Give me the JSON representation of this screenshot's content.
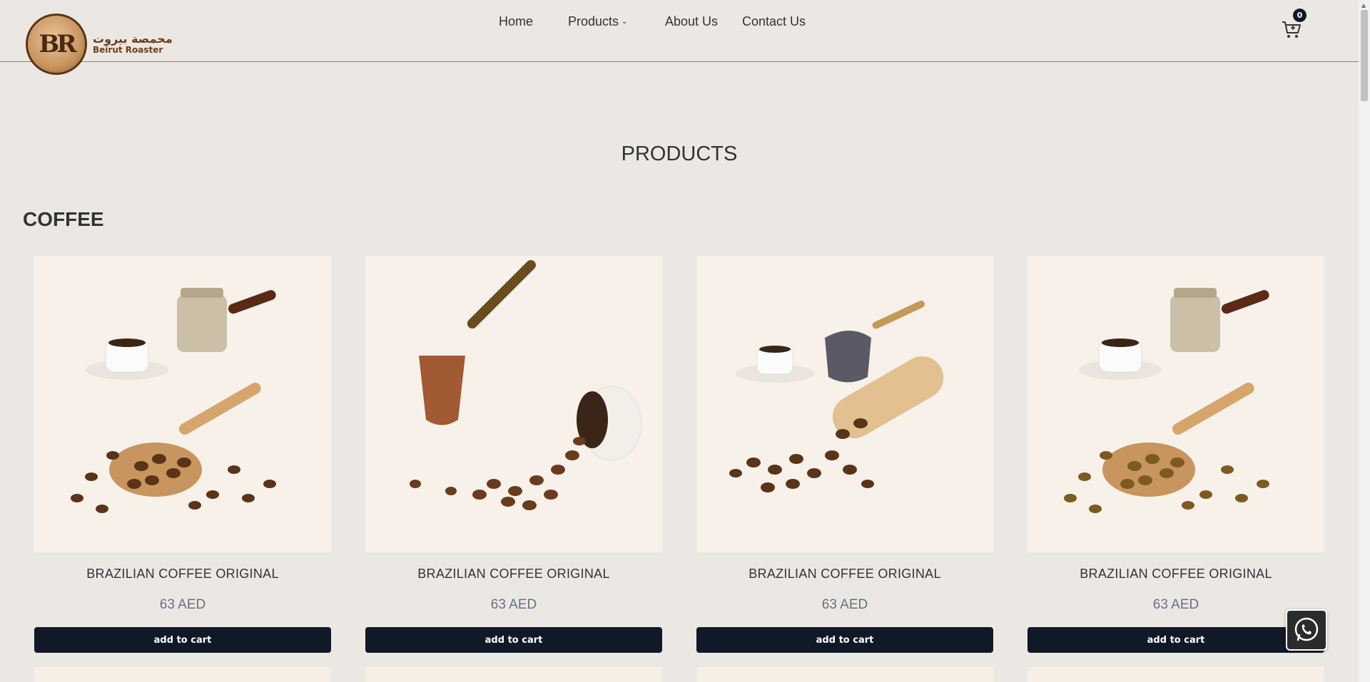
{
  "header": {
    "logo": {
      "monogram": "BR",
      "arabic_name": "محمصة بيروت",
      "english_name": "Beirut Roaster"
    },
    "nav": [
      {
        "label": "Home"
      },
      {
        "label": "Products",
        "has_dropdown": true
      },
      {
        "label": "About Us"
      },
      {
        "label": "Contact Us"
      }
    ],
    "cart": {
      "icon": "cart-icon",
      "count": "0"
    }
  },
  "page": {
    "title": "PRODUCTS"
  },
  "section": {
    "title": "COFFEE"
  },
  "products": [
    {
      "name": "BRAZILIAN COFFEE ORIGINAL",
      "price": "63 AED",
      "button": "add to cart",
      "image": "coffee-pot-spoon-beans"
    },
    {
      "name": "BRAZILIAN COFFEE ORIGINAL",
      "price": "63 AED",
      "button": "add to cart",
      "image": "copper-pot-spilled-cup"
    },
    {
      "name": "BRAZILIAN COFFEE ORIGINAL",
      "price": "63 AED",
      "button": "add to cart",
      "image": "pot-scoop-beans"
    },
    {
      "name": "BRAZILIAN COFFEE ORIGINAL",
      "price": "63 AED",
      "button": "add to cart",
      "image": "coffee-pot-spoon-green-beans"
    }
  ],
  "floating": {
    "whatsapp_icon": "whatsapp-icon"
  },
  "colors": {
    "background": "#ebe8e3",
    "button": "#111827",
    "price": "#667085",
    "brand_brown": "#6b3f1d"
  }
}
